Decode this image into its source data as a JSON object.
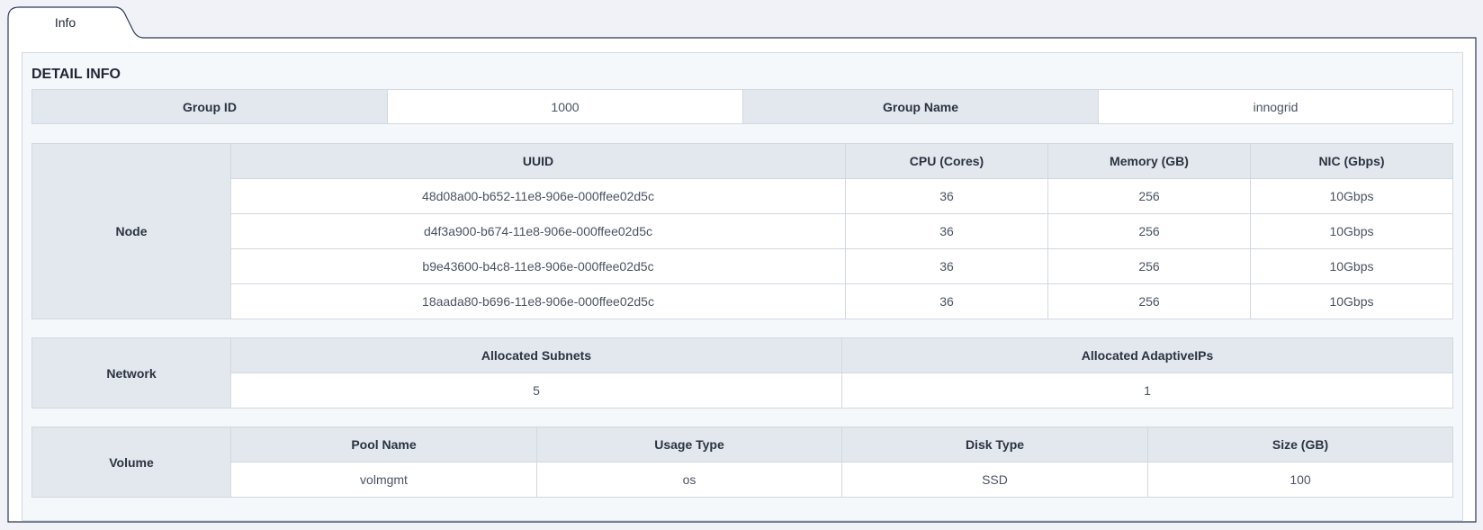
{
  "tabs": [
    {
      "label": "Info"
    }
  ],
  "section": {
    "title": "DETAIL INFO"
  },
  "group": {
    "id_label": "Group ID",
    "id_value": "1000",
    "name_label": "Group Name",
    "name_value": "innogrid"
  },
  "node": {
    "label": "Node",
    "headers": [
      "UUID",
      "CPU (Cores)",
      "Memory (GB)",
      "NIC (Gbps)"
    ],
    "rows": [
      [
        "48d08a00-b652-11e8-906e-000ffee02d5c",
        "36",
        "256",
        "10Gbps"
      ],
      [
        "d4f3a900-b674-11e8-906e-000ffee02d5c",
        "36",
        "256",
        "10Gbps"
      ],
      [
        "b9e43600-b4c8-11e8-906e-000ffee02d5c",
        "36",
        "256",
        "10Gbps"
      ],
      [
        "18aada80-b696-11e8-906e-000ffee02d5c",
        "36",
        "256",
        "10Gbps"
      ]
    ]
  },
  "network": {
    "label": "Network",
    "headers": [
      "Allocated Subnets",
      "Allocated AdaptiveIPs"
    ],
    "values": [
      "5",
      "1"
    ]
  },
  "volume": {
    "label": "Volume",
    "headers": [
      "Pool Name",
      "Usage Type",
      "Disk Type",
      "Size (GB)"
    ],
    "values": [
      "volmgmt",
      "os",
      "SSD",
      "100"
    ]
  }
}
